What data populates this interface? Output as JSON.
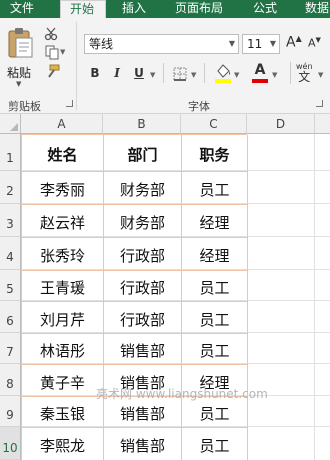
{
  "tabs": [
    "文件",
    "开始",
    "插入",
    "页面布局",
    "公式",
    "数据"
  ],
  "ribbon": {
    "paste_label": "粘贴",
    "clipboard_label": "剪贴板",
    "font_name": "等线",
    "font_size": "11",
    "grow_font": "A",
    "shrink_font": "A",
    "bold": "B",
    "italic": "I",
    "underline": "U",
    "font_color_letter": "A",
    "phonetic": "wén",
    "font_group_label": "字体",
    "colors": {
      "fill": "#ffff00",
      "font": "#e00000"
    }
  },
  "sheet": {
    "columns": [
      "A",
      "B",
      "C",
      "D"
    ],
    "rows": [
      "1",
      "2",
      "3",
      "4",
      "5",
      "6",
      "7",
      "8",
      "9",
      "10"
    ],
    "header": [
      "姓名",
      "部门",
      "职务"
    ],
    "data": [
      [
        "李秀丽",
        "财务部",
        "员工"
      ],
      [
        "赵云祥",
        "财务部",
        "经理"
      ],
      [
        "张秀玲",
        "行政部",
        "经理"
      ],
      [
        "王青瑗",
        "行政部",
        "员工"
      ],
      [
        "刘月芹",
        "行政部",
        "员工"
      ],
      [
        "林语彤",
        "销售部",
        "员工"
      ],
      [
        "黄子辛",
        "销售部",
        "经理"
      ],
      [
        "秦玉银",
        "销售部",
        "员工"
      ],
      [
        "李熙龙",
        "销售部",
        "员工"
      ]
    ]
  },
  "watermark": "亮术网 www.liangshunet.com"
}
